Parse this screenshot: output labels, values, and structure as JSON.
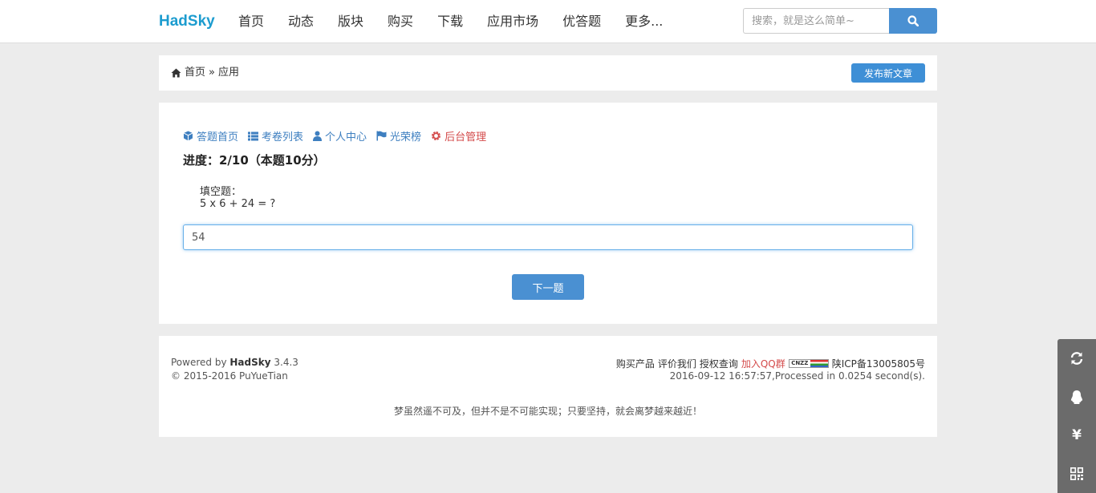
{
  "header": {
    "brand": "HadSky",
    "nav": [
      "首页",
      "动态",
      "版块",
      "购买",
      "下载",
      "应用市场",
      "优答题",
      "更多..."
    ],
    "search_placeholder": "搜索，就是这么简单~"
  },
  "breadcrumb": {
    "home": "首页",
    "separator": "»",
    "current": "应用",
    "publish_label": "发布新文章"
  },
  "quiz": {
    "subnav": {
      "home": "答题首页",
      "list": "考卷列表",
      "profile": "个人中心",
      "honor": "光荣榜",
      "admin": "后台管理"
    },
    "progress": "进度：2/10（本题10分）",
    "question_type": "填空题：",
    "question": "5 x 6 + 24 = ?",
    "answer_value": "54",
    "next_label": "下一题"
  },
  "footer": {
    "powered_prefix": "Powered by ",
    "powered_name": "HadSky",
    "version": " 3.4.3",
    "copyright": "© 2015-2016 PuYueTian",
    "links": [
      "购买产品",
      "评价我们",
      "授权查询"
    ],
    "qq_group": "加入QQ群",
    "cnzz": "CNZZ",
    "icp": "陕ICP备13005805号",
    "timing": "2016-09-12 16:57:57,Processed in 0.0254 second(s).",
    "motto": "梦虽然遥不可及，但并不是不可能实现；只要坚持，就会离梦越来越近！"
  },
  "side_tools": {
    "yen": "¥"
  },
  "colors": {
    "brand": "#1c9ccf",
    "primary": "#4a90d2",
    "link": "#3e7fc0",
    "danger": "#d44b4b"
  }
}
